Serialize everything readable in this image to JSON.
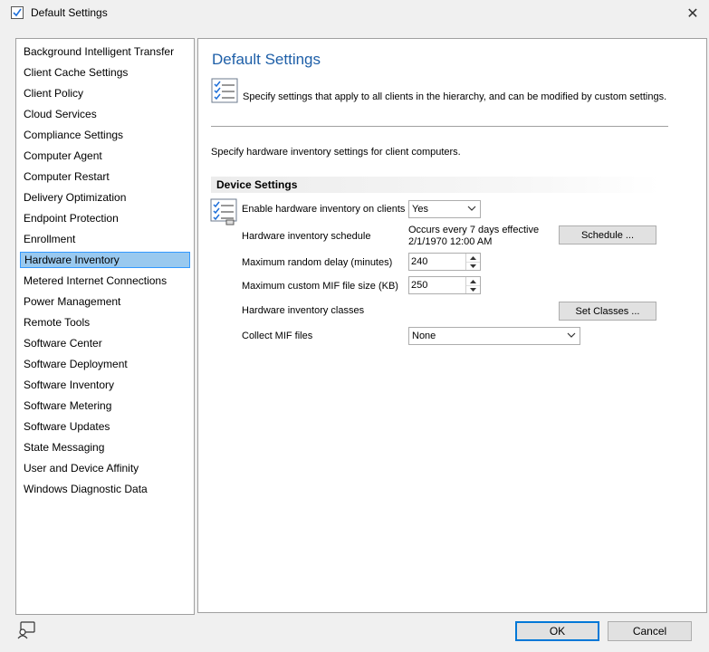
{
  "window": {
    "title": "Default Settings",
    "close_glyph": "✕"
  },
  "nav": {
    "items": [
      {
        "label": "Background Intelligent Transfer"
      },
      {
        "label": "Client Cache Settings"
      },
      {
        "label": "Client Policy"
      },
      {
        "label": "Cloud Services"
      },
      {
        "label": "Compliance Settings"
      },
      {
        "label": "Computer Agent"
      },
      {
        "label": "Computer Restart"
      },
      {
        "label": "Delivery Optimization"
      },
      {
        "label": "Endpoint Protection"
      },
      {
        "label": "Enrollment"
      },
      {
        "label": "Hardware Inventory"
      },
      {
        "label": "Metered Internet Connections"
      },
      {
        "label": "Power Management"
      },
      {
        "label": "Remote Tools"
      },
      {
        "label": "Software Center"
      },
      {
        "label": "Software Deployment"
      },
      {
        "label": "Software Inventory"
      },
      {
        "label": "Software Metering"
      },
      {
        "label": "Software Updates"
      },
      {
        "label": "State Messaging"
      },
      {
        "label": "User and Device Affinity"
      },
      {
        "label": "Windows Diagnostic Data"
      }
    ],
    "selected_index": 10
  },
  "content": {
    "title": "Default Settings",
    "intro": "Specify settings that apply to all clients in the hierarchy, and can be modified by custom settings.",
    "section_description": "Specify hardware inventory settings for client computers.",
    "group_header": "Device Settings",
    "settings": {
      "enable": {
        "label": "Enable hardware inventory on clients",
        "value": "Yes"
      },
      "schedule": {
        "label": "Hardware inventory schedule",
        "value_line1": "Occurs every 7 days effective",
        "value_line2": "2/1/1970 12:00 AM",
        "button": "Schedule ..."
      },
      "random_delay": {
        "label": "Maximum random delay (minutes)",
        "value": "240"
      },
      "mif_size": {
        "label": "Maximum custom MIF file size (KB)",
        "value": "250"
      },
      "classes": {
        "label": "Hardware inventory classes",
        "button": "Set Classes ..."
      },
      "collect_mif": {
        "label": "Collect MIF files",
        "value": "None"
      }
    }
  },
  "footer": {
    "ok": "OK",
    "cancel": "Cancel"
  },
  "colors": {
    "title_blue": "#1e5fa8",
    "selection_fill": "#99c9ef",
    "selection_border": "#3399ff",
    "default_button_border": "#0078d7"
  }
}
